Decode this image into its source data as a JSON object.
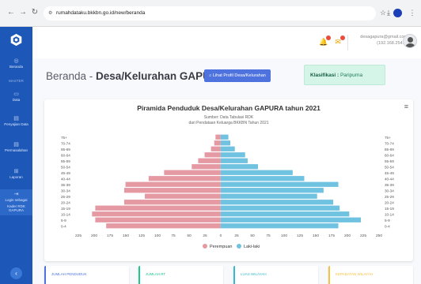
{
  "browser": {
    "url": "rumahdataku.bkkbn.go.id/new/beranda",
    "back_icon": "←",
    "forward_icon": "→",
    "reload_icon": "↻",
    "star_icon": "☆",
    "download_icon": "⤓",
    "menu_icon": "⋮"
  },
  "sidebar": {
    "items": [
      {
        "icon": "◎",
        "label": "Beranda"
      },
      {
        "icon": "",
        "label": "MASTER"
      },
      {
        "icon": "▭",
        "label": "Data"
      },
      {
        "icon": "▤",
        "label": "Penyajian Data"
      },
      {
        "icon": "▤",
        "label": "Permasalahan"
      },
      {
        "icon": "⊞",
        "label": "Laporan"
      },
      {
        "icon": "⇥",
        "label": "Login sebagai"
      },
      {
        "icon": "",
        "label": "Kader RDK GAPURA"
      }
    ],
    "toggle_icon": "‹"
  },
  "topbar": {
    "user_email": "desagapura@gmail.com",
    "user_sub": "(192.168.254.3)"
  },
  "page": {
    "title_prefix": "Beranda - ",
    "title_main": "Desa/Kelurahan GAPURA",
    "profile_button": "Lihat Profil Desa/Kelurahan",
    "klasifikasi_label": "Klasifikasi :",
    "klasifikasi_value": "Paripurna"
  },
  "colors": {
    "perempuan": "#e59aa3",
    "laki_laki": "#6fc3e0",
    "sidebar": "#1d58b8",
    "primary": "#4e73df"
  },
  "chart_data": {
    "type": "bar",
    "orientation": "horizontal-diverging",
    "title": "Piramida Penduduk Desa/Kelurahan GAPURA tahun 2021",
    "subtitle_1": "Sumber: Data Tabulasi RDK",
    "subtitle_2": "dari Pendataan Keluarga BKKBN Tahun 2021",
    "categories": [
      "75+",
      "70-74",
      "65-69",
      "60-64",
      "55-59",
      "50-54",
      "45-49",
      "40-44",
      "35-39",
      "30-34",
      "25-29",
      "20-24",
      "15-19",
      "10-14",
      "5-9",
      "0-4"
    ],
    "series": [
      {
        "name": "Perempuan",
        "values": [
          -8,
          -10,
          -15,
          -25,
          -35,
          -45,
          -88,
          -112,
          -148,
          -150,
          -118,
          -150,
          -195,
          -200,
          -195,
          -178
        ]
      },
      {
        "name": "Laki-laki",
        "values": [
          12,
          15,
          22,
          38,
          42,
          58,
          112,
          130,
          183,
          160,
          150,
          175,
          185,
          200,
          218,
          183
        ]
      }
    ],
    "x_ticks": [
      "225",
      "200",
      "175",
      "150",
      "125",
      "100",
      "75",
      "50",
      "25",
      "0",
      "25",
      "50",
      "75",
      "100",
      "125",
      "150",
      "175",
      "200",
      "225",
      "250"
    ],
    "xlim": [
      -225,
      250
    ],
    "legend": [
      "Perempuan",
      "Laki-laki"
    ],
    "legend_position": "bottom",
    "menu_icon": "≡"
  },
  "stat_cards": [
    {
      "label": "Jumlah Penduduk"
    },
    {
      "label": "Jumlah RT"
    },
    {
      "label": "Luas Wilayah"
    },
    {
      "label": "Kepadatan Wilayah"
    }
  ]
}
